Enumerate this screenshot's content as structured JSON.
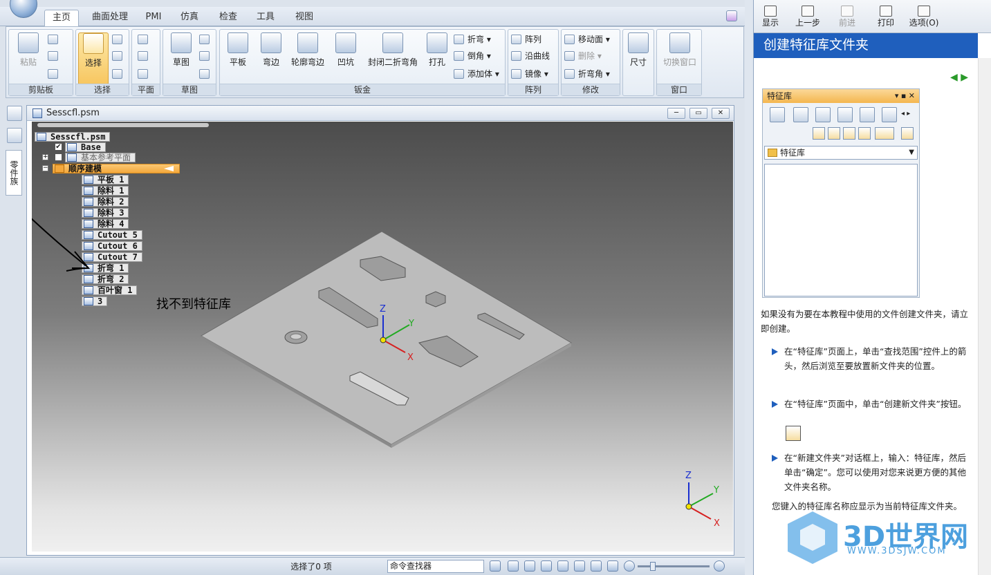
{
  "ribbon": {
    "tabs": [
      "主页",
      "曲面处理",
      "PMI",
      "仿真",
      "检查",
      "工具",
      "视图"
    ],
    "groups": {
      "clipboard": {
        "label": "剪贴板",
        "paste": "粘贴"
      },
      "select": {
        "label": "选择",
        "select": "选择"
      },
      "plane": {
        "label": "平面"
      },
      "sketch": {
        "label": "草图",
        "sketch": "草图"
      },
      "sheetmetal": {
        "label": "钣金",
        "items": [
          "平板",
          "弯边",
          "轮廓弯边",
          "凹坑",
          "封闭二折弯角",
          "打孔"
        ],
        "small": [
          "折弯",
          "倒角",
          "添加体"
        ]
      },
      "pattern": {
        "label": "阵列",
        "items": [
          "阵列",
          "沿曲线",
          "镜像"
        ]
      },
      "modify": {
        "label": "修改",
        "items": [
          "移动面",
          "删除",
          "折弯角"
        ]
      },
      "dimension": {
        "label": "尺寸"
      },
      "window": {
        "label": "窗口",
        "switch": "切换窗口"
      }
    }
  },
  "left_strip": {
    "tab_label": "零件族"
  },
  "document": {
    "title": "Sesscfl.psm",
    "tree": {
      "root": "Sesscfl.psm",
      "base": "Base",
      "refplanes": "基本参考平面",
      "ordered": "顺序建模",
      "features": [
        "平板 1",
        "除料 1",
        "除料 2",
        "除料 3",
        "除料 4",
        "Cutout 5",
        "Cutout 6",
        "Cutout 7",
        "折弯 1",
        "折弯 2",
        "百叶窗 1",
        "3"
      ]
    },
    "annotation": "找不到特征库",
    "axes": {
      "z": "Z",
      "y": "Y",
      "x": "X"
    }
  },
  "status": {
    "selected": "选择了0 项",
    "command_finder": "命令查找器"
  },
  "help": {
    "toolbar": [
      "显示",
      "上一步",
      "前进",
      "打印",
      "选项(O)"
    ],
    "title": "创建特征库文件夹",
    "feature_library": {
      "title": "特征库",
      "folder": "特征库"
    },
    "intro": "如果没有为要在本教程中使用的文件创建文件夹，请立即创建。",
    "steps": [
      "在“特征库”页面上，单击“查找范围”控件上的箭头，然后浏览至要放置新文件夹的位置。",
      "在“特征库”页面中，单击“创建新文件夹”按钮。",
      "在“新建文件夹”对话框上，输入：特征库，然后单击“确定”。您可以使用对您来说更方便的其他文件夹名称。"
    ],
    "footer": "您键入的特征库名称应显示为当前特征库文件夹。",
    "watermark": {
      "brand": "3D世界网",
      "url": "WWW.3DSJW.COM"
    }
  },
  "colors": {
    "help_header": "#1f5fbd",
    "selected_node": "#f4a83c",
    "axis_x": "#d62020",
    "axis_y": "#22aa22",
    "axis_z": "#1a2fd0",
    "watermark": "#4da0de"
  }
}
